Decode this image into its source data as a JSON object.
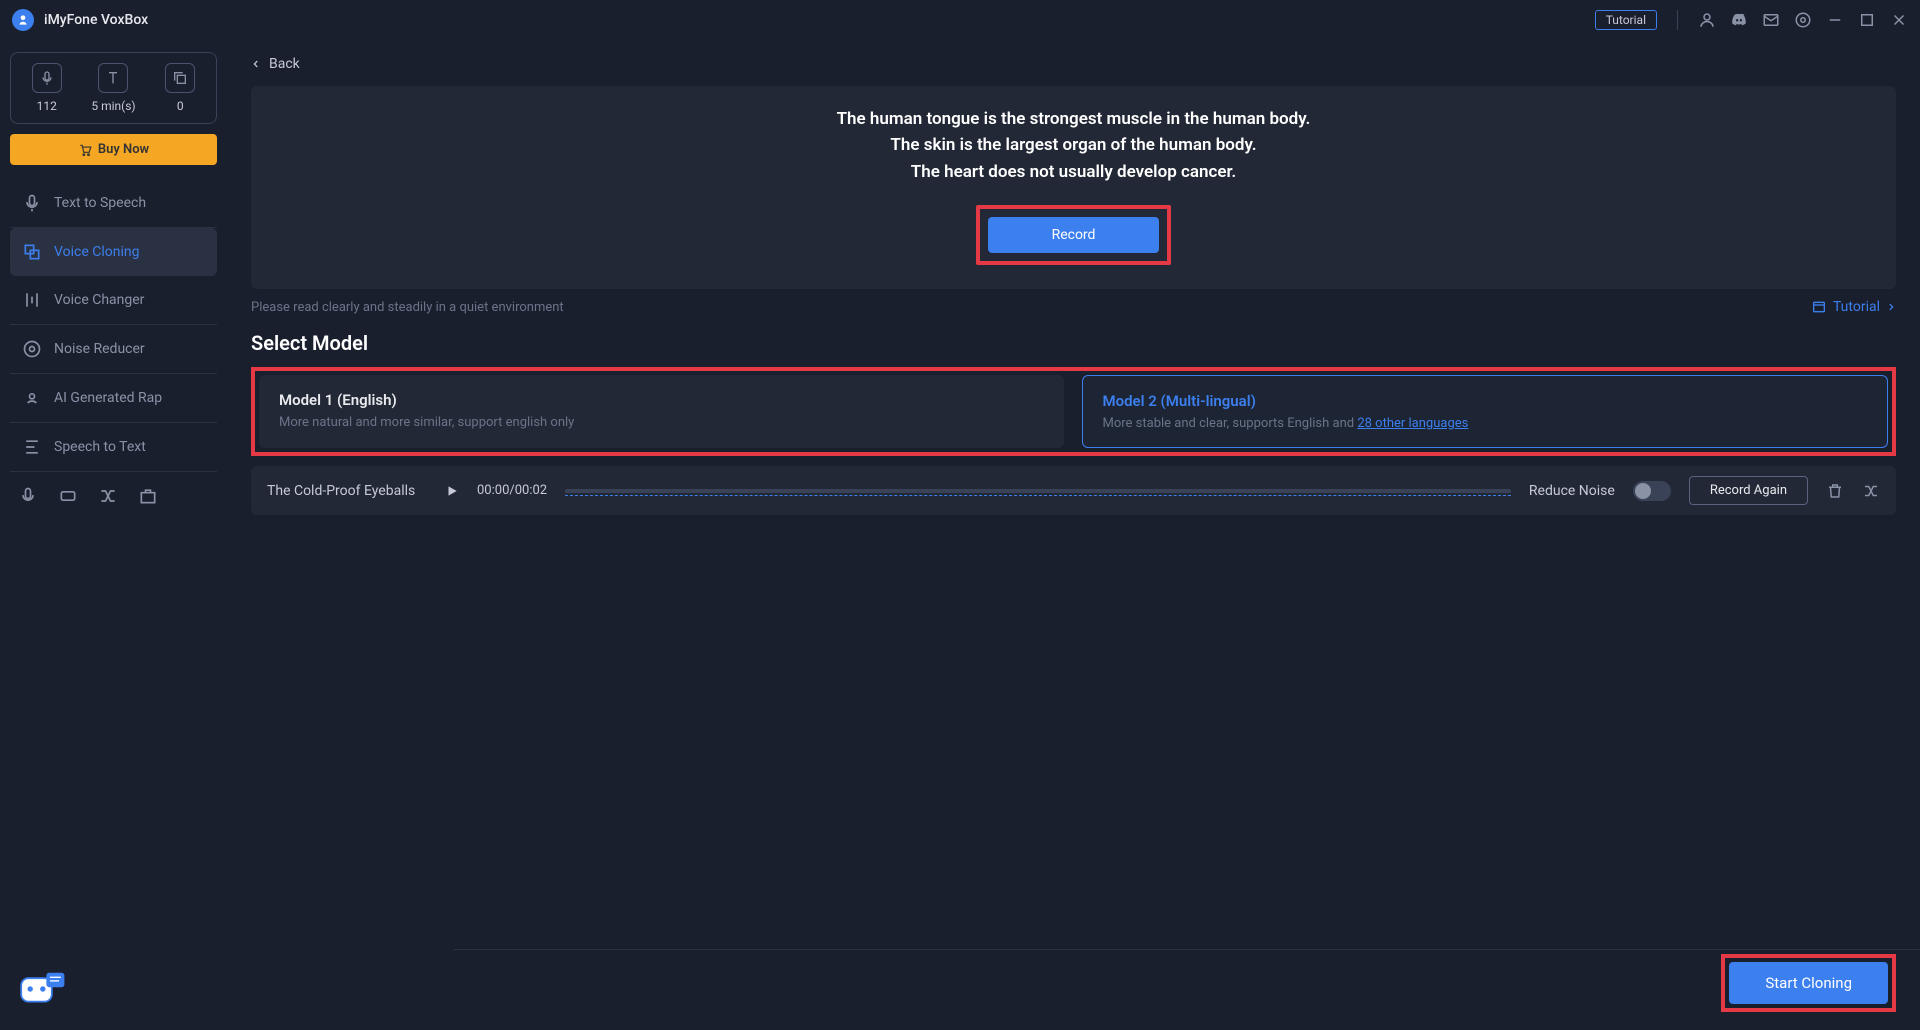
{
  "app": {
    "title": "iMyFone VoxBox",
    "tutorial_badge": "Tutorial"
  },
  "sidebar": {
    "credits": [
      {
        "value": "112"
      },
      {
        "value": "5 min(s)"
      },
      {
        "value": "0"
      }
    ],
    "buy_now": "Buy Now",
    "nav": [
      {
        "label": "Text to Speech"
      },
      {
        "label": "Voice Cloning"
      },
      {
        "label": "Voice Changer"
      },
      {
        "label": "Noise Reducer"
      },
      {
        "label": "AI Generated Rap"
      },
      {
        "label": "Speech to Text"
      }
    ]
  },
  "main": {
    "back": "Back",
    "prompt_line1": "The human tongue is the strongest muscle in the human body.",
    "prompt_line2": "The skin is the largest organ of the human body.",
    "prompt_line3": "The heart does not usually develop cancer.",
    "record": "Record",
    "hint": "Please read clearly and steadily in a quiet environment",
    "tutorial_link": "Tutorial",
    "section_title": "Select Model",
    "models": [
      {
        "title": "Model 1 (English)",
        "desc": "More natural and more similar, support english only"
      },
      {
        "title": "Model 2 (Multi-lingual)",
        "desc_prefix": "More stable and clear, supports English and ",
        "lang_link": "28 other languages"
      }
    ],
    "player": {
      "track": "The Cold-Proof Eyeballs",
      "time": "00:00/00:02",
      "reduce_noise": "Reduce Noise",
      "record_again": "Record Again"
    },
    "start": "Start Cloning"
  }
}
